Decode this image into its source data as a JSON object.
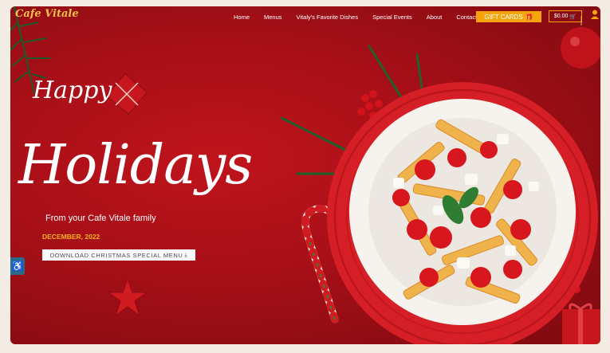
{
  "header": {
    "logo_text": "Cafe Vitale",
    "nav": [
      "Home",
      "Menus",
      "Vitaly's Favorite Dishes",
      "Special Events",
      "About",
      "Contact"
    ],
    "gift_cards_label": "GIFT CARDS",
    "cart_label": "$0.00"
  },
  "hero": {
    "happy": "Happy",
    "holidays": "Holidays",
    "tagline": "From your Cafe Vitale family",
    "date": "DECEMBER, 2022",
    "download_label": "DOWNLOAD CHRISTMAS SPECIAL MENU"
  },
  "colors": {
    "accent": "#f5a40c",
    "background": "#a60f17",
    "date": "#f5b21c"
  },
  "icons": [
    "gift-icon",
    "cart-icon",
    "user-icon",
    "download-icon",
    "accessibility-icon"
  ]
}
